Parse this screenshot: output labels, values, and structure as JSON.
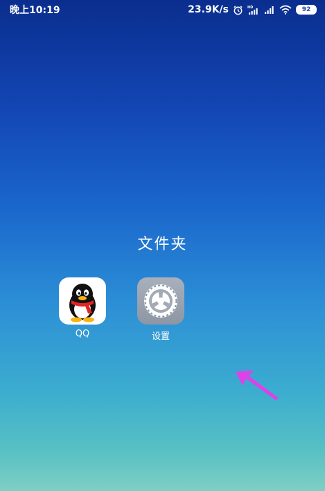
{
  "status_bar": {
    "time": "晚上10:19",
    "net_speed": "23.9K/s",
    "battery": "92"
  },
  "folder": {
    "title": "文件夹",
    "apps": [
      {
        "label": "QQ",
        "icon": "qq-penguin-icon"
      },
      {
        "label": "设置",
        "icon": "settings-gear-icon"
      }
    ]
  },
  "icons": [
    "alarm-clock-icon",
    "hd-signal-icon",
    "signal-icon",
    "wifi-icon",
    "battery-icon"
  ],
  "colors": {
    "arrow": "#e040e8",
    "background_top": "#0a2e8e",
    "background_bottom": "#7fcfc4"
  }
}
